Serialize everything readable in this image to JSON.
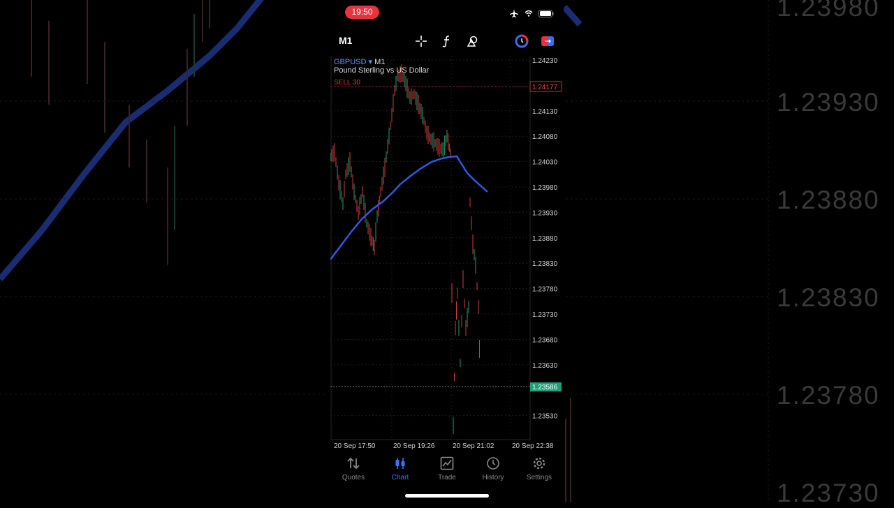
{
  "status_bar": {
    "time": "19:50"
  },
  "toolbar": {
    "timeframe": "M1"
  },
  "symbol": {
    "name": "GBPUSD",
    "dropdown_glyph": "▾",
    "timeframe": "M1",
    "description": "Pound Sterling vs US Dollar"
  },
  "order_line": {
    "label": "SELL 30",
    "price": "1.24177"
  },
  "bid_line": {
    "price": "1.23586"
  },
  "price_axis": [
    "1.24230",
    "1.24130",
    "1.24080",
    "1.24030",
    "1.23980",
    "1.23930",
    "1.23880",
    "1.23830",
    "1.23780",
    "1.23730",
    "1.23680",
    "1.23630",
    "1.23530"
  ],
  "time_axis": [
    "20 Sep 17:50",
    "20 Sep 19:26",
    "20 Sep 21:02",
    "20 Sep 22:38"
  ],
  "tabs": [
    {
      "label": "Quotes",
      "icon": "quotes-icon",
      "active": false
    },
    {
      "label": "Chart",
      "icon": "chart-icon",
      "active": true
    },
    {
      "label": "Trade",
      "icon": "trade-icon",
      "active": false
    },
    {
      "label": "History",
      "icon": "history-icon",
      "active": false
    },
    {
      "label": "Settings",
      "icon": "settings-icon",
      "active": false
    }
  ],
  "background_axis": [
    "1.23980",
    "1.23930",
    "1.23880",
    "1.23830",
    "1.23780",
    "1.23730"
  ],
  "colors": {
    "up": "#1f9e78",
    "down": "#d23c3c",
    "ma": "#2f5be0",
    "accent": "#3478f6",
    "clock": "#e8333b"
  }
}
